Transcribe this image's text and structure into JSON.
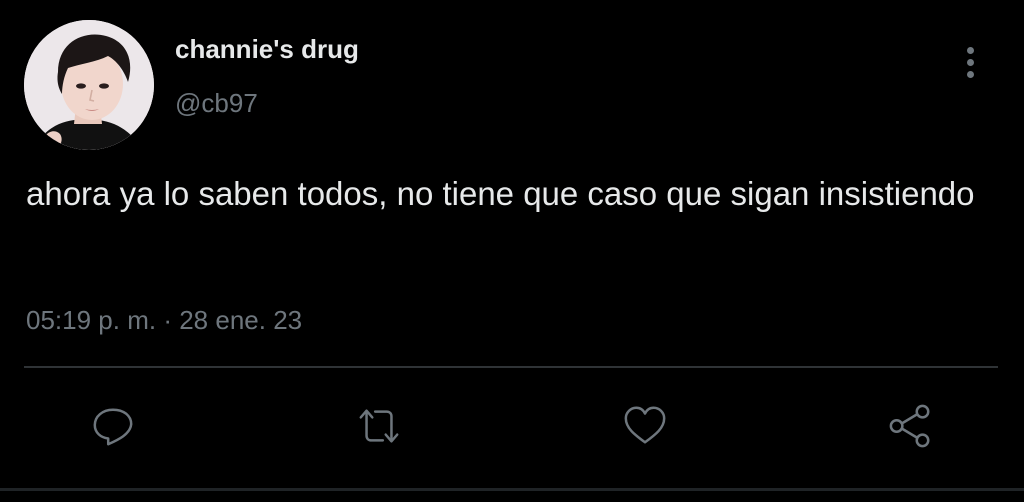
{
  "tweet": {
    "author": {
      "display_name": "channie's drug",
      "handle": "@cb97",
      "avatar_icon": "profile-photo"
    },
    "text": "ahora ya lo saben todos, no tiene que caso que sigan insistiendo",
    "time": "05:19 p. m.",
    "separator": "·",
    "date": "28 ene. 23",
    "more_icon": "more-vertical-icon"
  },
  "actions": [
    {
      "name": "reply",
      "icon": "reply-icon"
    },
    {
      "name": "retweet",
      "icon": "retweet-icon"
    },
    {
      "name": "like",
      "icon": "heart-icon"
    },
    {
      "name": "share",
      "icon": "share-icon"
    }
  ],
  "colors": {
    "background": "#000000",
    "primary_text": "#e7e9ea",
    "secondary_text": "#6e767d",
    "divider": "#2f3336"
  }
}
